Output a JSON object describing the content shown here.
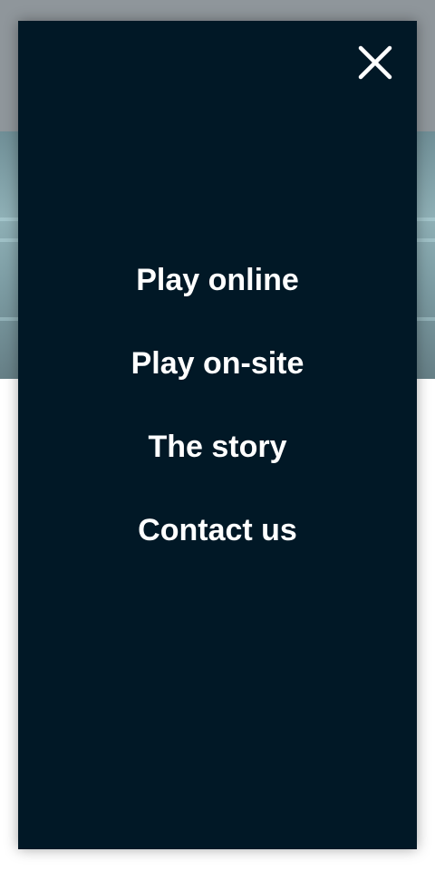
{
  "menu": {
    "close_icon": "close-icon",
    "items": [
      {
        "label": "Play online"
      },
      {
        "label": "Play on-site"
      },
      {
        "label": "The story"
      },
      {
        "label": "Contact us"
      }
    ]
  },
  "colors": {
    "panel_background": "#011826",
    "menu_text": "#ffffff",
    "backdrop_header": "#8f969b"
  }
}
